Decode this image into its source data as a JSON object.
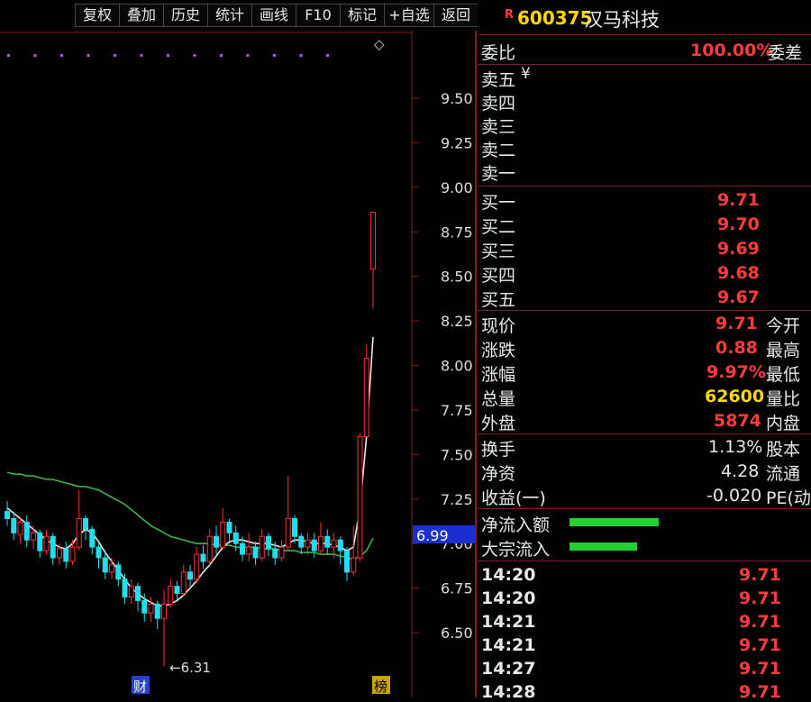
{
  "toolbar": {
    "buttons": [
      "复权",
      "叠加",
      "历史",
      "统计",
      "画线",
      "F10",
      "标记",
      "+自选",
      "返回"
    ]
  },
  "chart": {
    "axis_ticks": [
      "9.50",
      "9.25",
      "9.00",
      "8.75",
      "8.50",
      "8.25",
      "8.00",
      "7.75",
      "7.50",
      "7.25",
      "7.00",
      "6.75",
      "6.50"
    ],
    "current_price_tag": "6.99",
    "low_label": "←6.31",
    "marker_left": "财",
    "marker_right": "榜",
    "diamond": "◇",
    "colors": {
      "up": "#ff3030",
      "down": "#22ddee",
      "ma_short": "#e8e8e8",
      "ma_long": "#39b54a",
      "border": "#8b1a1a",
      "tag_bg": "#1a2fd0"
    }
  },
  "header": {
    "r_badge": "R",
    "code": "600375",
    "name": "汉马科技"
  },
  "order_book": {
    "ratio_label": "委比",
    "ratio_value": "100.00%",
    "diff_label": "委差",
    "sells": [
      {
        "label": "卖五",
        "extra": "¥"
      },
      {
        "label": "卖四",
        "extra": ""
      },
      {
        "label": "卖三",
        "extra": ""
      },
      {
        "label": "卖二",
        "extra": ""
      },
      {
        "label": "卖一",
        "extra": ""
      }
    ],
    "buys": [
      {
        "label": "买一",
        "price": "9.71"
      },
      {
        "label": "买二",
        "price": "9.70"
      },
      {
        "label": "买三",
        "price": "9.69"
      },
      {
        "label": "买四",
        "price": "9.68"
      },
      {
        "label": "买五",
        "price": "9.67"
      }
    ]
  },
  "quote": [
    {
      "label": "现价",
      "value": "9.71",
      "color": "red",
      "label2": "今开"
    },
    {
      "label": "涨跌",
      "value": "0.88",
      "color": "red",
      "label2": "最高"
    },
    {
      "label": "涨幅",
      "value": "9.97%",
      "color": "red",
      "label2": "最低"
    },
    {
      "label": "总量",
      "value": "62600",
      "color": "yel",
      "label2": "量比"
    },
    {
      "label": "外盘",
      "value": "5874",
      "color": "red",
      "label2": "内盘"
    }
  ],
  "fundamentals": [
    {
      "label": "换手",
      "value": "1.13%",
      "label2": "股本"
    },
    {
      "label": "净资",
      "value": "4.28",
      "label2": "流通"
    },
    {
      "label": "收益(一)",
      "value": "-0.020",
      "label2": "PE(动"
    }
  ],
  "flows": [
    {
      "label": "净流入额",
      "bar_fraction": 0.9
    },
    {
      "label": "大宗流入",
      "bar_fraction": 0.68
    }
  ],
  "ticks": [
    {
      "time": "14:20",
      "price": "9.71"
    },
    {
      "time": "14:20",
      "price": "9.71"
    },
    {
      "time": "14:21",
      "price": "9.71"
    },
    {
      "time": "14:21",
      "price": "9.71"
    },
    {
      "time": "14:27",
      "price": "9.71"
    },
    {
      "time": "14:28",
      "price": "9.71"
    }
  ],
  "chart_data": {
    "type": "candlestick",
    "ylim": [
      6.3,
      9.7
    ],
    "candles": [
      [
        7.18,
        7.14,
        7.24,
        7.1
      ],
      [
        7.14,
        7.06,
        7.18,
        7.02
      ],
      [
        7.05,
        7.12,
        7.15,
        7.0
      ],
      [
        7.12,
        7.02,
        7.16,
        6.98
      ],
      [
        7.02,
        7.06,
        7.1,
        6.97
      ],
      [
        7.06,
        6.96,
        7.08,
        6.92
      ],
      [
        6.96,
        7.04,
        7.08,
        6.94
      ],
      [
        7.04,
        6.92,
        7.06,
        6.88
      ],
      [
        6.92,
        6.97,
        7.0,
        6.88
      ],
      [
        6.97,
        6.9,
        7.01,
        6.86
      ],
      [
        6.9,
        6.98,
        7.02,
        6.88
      ],
      [
        6.98,
        7.14,
        7.3,
        6.96
      ],
      [
        7.14,
        7.08,
        7.16,
        7.02
      ],
      [
        7.08,
        6.98,
        7.1,
        6.94
      ],
      [
        6.98,
        6.92,
        7.0,
        6.86
      ],
      [
        6.92,
        6.84,
        6.95,
        6.8
      ],
      [
        6.84,
        6.88,
        6.92,
        6.8
      ],
      [
        6.88,
        6.8,
        6.9,
        6.76
      ],
      [
        6.8,
        6.7,
        6.83,
        6.66
      ],
      [
        6.7,
        6.76,
        6.8,
        6.66
      ],
      [
        6.76,
        6.68,
        6.78,
        6.62
      ],
      [
        6.68,
        6.61,
        6.72,
        6.56
      ],
      [
        6.61,
        6.66,
        6.7,
        6.56
      ],
      [
        6.66,
        6.58,
        6.68,
        6.52
      ],
      [
        6.58,
        6.66,
        6.74,
        6.31
      ],
      [
        6.66,
        6.76,
        6.8,
        6.64
      ],
      [
        6.76,
        6.72,
        6.79,
        6.68
      ],
      [
        6.72,
        6.84,
        6.88,
        6.7
      ],
      [
        6.84,
        6.8,
        6.88,
        6.76
      ],
      [
        6.8,
        6.94,
        6.98,
        6.78
      ],
      [
        6.94,
        6.9,
        6.99,
        6.86
      ],
      [
        6.9,
        7.04,
        7.08,
        6.88
      ],
      [
        7.04,
        6.98,
        7.1,
        6.94
      ],
      [
        6.98,
        7.12,
        7.2,
        6.96
      ],
      [
        7.12,
        7.06,
        7.14,
        7.0
      ],
      [
        7.06,
        7.0,
        7.1,
        6.96
      ],
      [
        7.0,
        6.94,
        7.04,
        6.9
      ],
      [
        6.94,
        6.98,
        7.06,
        6.9
      ],
      [
        6.98,
        6.92,
        7.01,
        6.88
      ],
      [
        6.92,
        7.04,
        7.08,
        6.9
      ],
      [
        7.04,
        6.97,
        7.06,
        6.93
      ],
      [
        6.97,
        6.92,
        7.01,
        6.88
      ],
      [
        6.92,
        6.98,
        7.02,
        6.9
      ],
      [
        6.98,
        7.14,
        7.38,
        6.96
      ],
      [
        7.14,
        7.04,
        7.16,
        7.0
      ],
      [
        7.04,
        6.98,
        7.06,
        6.94
      ],
      [
        6.98,
        7.02,
        7.06,
        6.94
      ],
      [
        7.02,
        6.96,
        7.06,
        6.92
      ],
      [
        6.96,
        7.04,
        7.12,
        6.94
      ],
      [
        7.04,
        6.98,
        7.08,
        6.94
      ],
      [
        6.98,
        7.02,
        7.06,
        6.92
      ],
      [
        7.02,
        6.96,
        7.04,
        6.88
      ],
      [
        6.96,
        6.84,
        6.98,
        6.79
      ],
      [
        6.84,
        6.92,
        7.1,
        6.82
      ],
      [
        6.92,
        7.6,
        7.62,
        6.9
      ],
      [
        7.6,
        8.04,
        8.12,
        7.6
      ],
      [
        8.54,
        8.86,
        8.86,
        8.32
      ]
    ],
    "ma_short": [
      7.2,
      7.17,
      7.14,
      7.11,
      7.08,
      7.05,
      7.02,
      7.0,
      6.98,
      6.97,
      7.0,
      7.05,
      7.08,
      7.06,
      7.01,
      6.95,
      6.9,
      6.85,
      6.8,
      6.75,
      6.72,
      6.69,
      6.67,
      6.65,
      6.65,
      6.66,
      6.68,
      6.71,
      6.75,
      6.79,
      6.84,
      6.88,
      6.93,
      6.98,
      7.01,
      7.02,
      7.02,
      7.01,
      7.0,
      7.0,
      7.0,
      6.99,
      6.98,
      7.0,
      7.02,
      7.02,
      7.01,
      7.0,
      7.0,
      7.0,
      6.99,
      6.98,
      6.96,
      6.98,
      7.2,
      7.6,
      8.16
    ],
    "ma_long": [
      7.4,
      7.39,
      7.39,
      7.38,
      7.38,
      7.37,
      7.36,
      7.36,
      7.35,
      7.34,
      7.33,
      7.32,
      7.32,
      7.31,
      7.3,
      7.28,
      7.26,
      7.24,
      7.22,
      7.19,
      7.16,
      7.13,
      7.1,
      7.08,
      7.06,
      7.04,
      7.03,
      7.02,
      7.01,
      7.0,
      7.0,
      7.0,
      6.99,
      6.99,
      6.99,
      6.98,
      6.98,
      6.98,
      6.98,
      6.97,
      6.97,
      6.97,
      6.96,
      6.96,
      6.96,
      6.95,
      6.95,
      6.95,
      6.94,
      6.94,
      6.94,
      6.93,
      6.92,
      6.91,
      6.93,
      6.96,
      7.03
    ]
  }
}
